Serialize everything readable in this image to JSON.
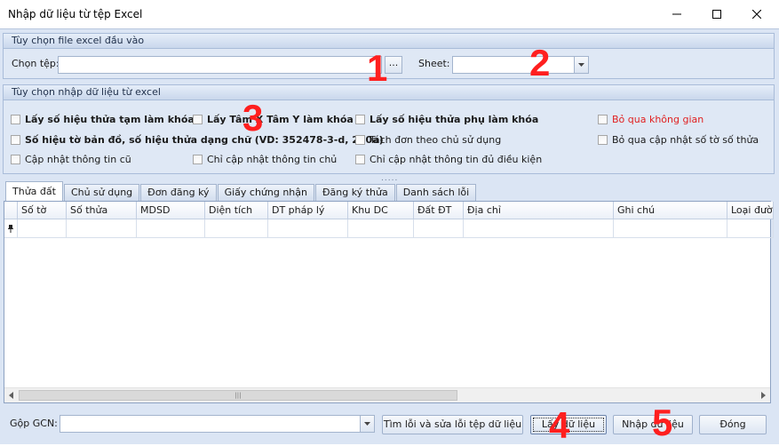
{
  "window": {
    "title": "Nhập dữ liệu từ tệp Excel",
    "minimize_icon": "minimize-icon",
    "maximize_icon": "maximize-icon",
    "close_icon": "close-icon"
  },
  "file_group": {
    "header": "Tùy chọn file excel đầu vào",
    "choose_file_label": "Chọn tệp:",
    "choose_file_value": "",
    "browse_label": "...",
    "sheet_label": "Sheet:",
    "sheet_value": ""
  },
  "import_group": {
    "header": "Tùy chọn nhập dữ liệu từ excel",
    "options": [
      {
        "label": "Lấy số hiệu thửa tạm làm khóa",
        "checked": false
      },
      {
        "label": "Lấy Tâm X Tâm Y làm khóa",
        "checked": false
      },
      {
        "label": "Lấy số hiệu thửa phụ làm khóa",
        "checked": false
      },
      {
        "label": "Bỏ qua không gian",
        "checked": false
      },
      {
        "label": "Số hiệu tờ bản đồ, số hiệu thửa dạng chữ (VD: 352478-3-d, 280a)",
        "checked": false
      },
      {
        "label": "Tách đơn theo chủ sử dụng",
        "checked": false
      },
      {
        "label": "Bỏ qua cập nhật số tờ số thửa",
        "checked": false
      },
      {
        "label": "Cập nhật thông tin cũ",
        "checked": false
      },
      {
        "label": "Chỉ cập nhật thông tin chủ",
        "checked": false
      },
      {
        "label": "Chỉ cập nhật thông tin đủ điều kiện",
        "checked": false
      }
    ],
    "splitter": "....."
  },
  "tabs": [
    {
      "label": "Thửa đất",
      "active": true
    },
    {
      "label": "Chủ sử dụng",
      "active": false
    },
    {
      "label": "Đơn đăng ký",
      "active": false
    },
    {
      "label": "Giấy chứng nhận",
      "active": false
    },
    {
      "label": "Đăng ký thửa",
      "active": false
    },
    {
      "label": "Danh sách lỗi",
      "active": false
    }
  ],
  "grid": {
    "columns": [
      "",
      "Số tờ",
      "Số thửa",
      "MDSD",
      "Diện tích",
      "DT pháp lý",
      "Khu DC",
      "Đất ĐT",
      "Địa chỉ",
      "Ghi chú",
      "Loại đườn"
    ],
    "new_row_marker": "pin-icon",
    "rows": [],
    "scroll_thumb_grip": "|||"
  },
  "bottom": {
    "merge_label": "Gộp GCN:",
    "merge_value": "",
    "find_fix_button": "Tìm lỗi và sửa lỗi tệp dữ liệu",
    "get_data_button": "Lấy dữ liệu",
    "import_button": "Nhập dữ liệu",
    "close_button": "Đóng"
  },
  "annotations": [
    "1",
    "2",
    "3",
    "4",
    "5"
  ],
  "colors": {
    "annotation": "#ff1f1f",
    "panel_bg": "#dbe5f4",
    "header_grad_top": "#e6eef9",
    "header_grad_bottom": "#c9d7ec",
    "option_red": "#e02020"
  }
}
